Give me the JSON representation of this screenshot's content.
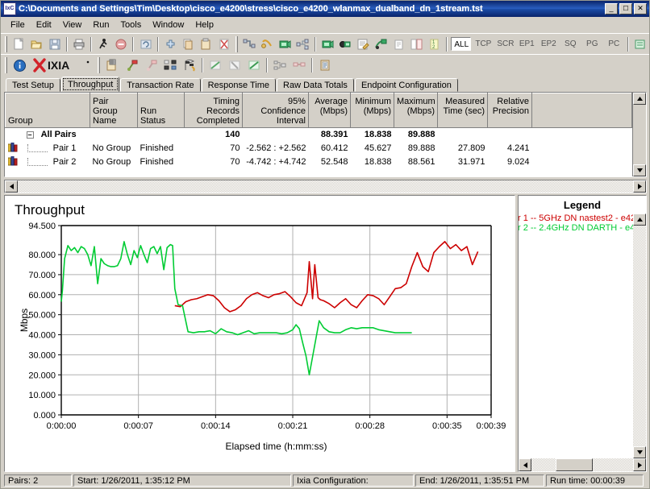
{
  "window": {
    "title": "C:\\Documents and Settings\\Tim\\Desktop\\cisco_e4200\\stress\\cisco_e4200_wlanmax_dualband_dn_1stream.tst",
    "icon": "ixchariot-icon",
    "minimize_label": "_",
    "maximize_label": "□",
    "close_label": "✕"
  },
  "menu": {
    "items": [
      "File",
      "Edit",
      "View",
      "Run",
      "Tools",
      "Window",
      "Help"
    ]
  },
  "toolbar": {
    "filter_buttons": [
      "ALL",
      "TCP",
      "SCR",
      "EP1",
      "EP2",
      "SQ",
      "PG",
      "PC"
    ],
    "filter_selected": "ALL",
    "brand": "IXIA"
  },
  "tabs": {
    "items": [
      "Test Setup",
      "Throughput",
      "Transaction Rate",
      "Response Time",
      "Raw Data Totals",
      "Endpoint Configuration"
    ],
    "active": "Throughput"
  },
  "table": {
    "columns": [
      "Group",
      "Pair Group Name",
      "Run Status",
      "Timing Records Completed",
      "95% Confidence Interval",
      "Average (Mbps)",
      "Minimum (Mbps)",
      "Maximum (Mbps)",
      "Measured Time (sec)",
      "Relative Precision",
      ""
    ],
    "rows": [
      {
        "type": "group",
        "group": "All Pairs",
        "pair_group_name": "",
        "run_status": "",
        "timing_records": "140",
        "confidence": "",
        "average": "88.391",
        "minimum": "18.838",
        "maximum": "89.888",
        "measured_time": "",
        "relative_precision": ""
      },
      {
        "type": "pair",
        "group": "Pair 1",
        "pair_group_name": "No Group",
        "run_status": "Finished",
        "timing_records": "70",
        "confidence": "-2.562 : +2.562",
        "average": "60.412",
        "minimum": "45.627",
        "maximum": "89.888",
        "measured_time": "27.809",
        "relative_precision": "4.241"
      },
      {
        "type": "pair",
        "group": "Pair 2",
        "pair_group_name": "No Group",
        "run_status": "Finished",
        "timing_records": "70",
        "confidence": "-4.742 : +4.742",
        "average": "52.548",
        "minimum": "18.838",
        "maximum": "88.561",
        "measured_time": "31.971",
        "relative_precision": "9.024"
      }
    ]
  },
  "legend": {
    "title": "Legend",
    "entries": [
      {
        "label": "r 1 -- 5GHz DN nastest2 - e42",
        "color": "#cc0000"
      },
      {
        "label": "r 2 -- 2.4GHz DN DARTH - e4",
        "color": "#00cc33"
      }
    ]
  },
  "statusbar": {
    "pairs": "Pairs: 2",
    "start": "Start: 1/26/2011, 1:35:12 PM",
    "configuration": "Ixia Configuration:",
    "end": "End: 1/26/2011, 1:35:51 PM",
    "runtime": "Run time: 00:00:39"
  },
  "chart_data": {
    "type": "line",
    "title": "Throughput",
    "xlabel": "Elapsed time (h:mm:ss)",
    "ylabel": "Mbps",
    "ylim": [
      0,
      94.5
    ],
    "yticks": [
      "0.000",
      "10.000",
      "20.000",
      "30.000",
      "40.000",
      "50.000",
      "60.000",
      "70.000",
      "80.000",
      "94.500"
    ],
    "ytick_values": [
      0,
      10,
      20,
      30,
      40,
      50,
      60,
      70,
      80,
      94.5
    ],
    "xlim": [
      0,
      39
    ],
    "xticks": [
      "0:00:00",
      "0:00:07",
      "0:00:14",
      "0:00:21",
      "0:00:28",
      "0:00:35",
      "0:00:39"
    ],
    "xtick_values": [
      0,
      7,
      14,
      21,
      28,
      35,
      39
    ],
    "grid": true,
    "legend_position": "right-panel",
    "series": [
      {
        "name": "r 1 -- 5GHz DN nastest2 - e42",
        "color": "#cc0000",
        "x": [
          10.3,
          10.8,
          11.3,
          11.8,
          12.3,
          12.8,
          13.3,
          13.8,
          14.3,
          14.8,
          15.3,
          15.8,
          16.3,
          16.8,
          17.3,
          17.8,
          18.3,
          18.8,
          19.3,
          19.8,
          20.3,
          20.8,
          21.3,
          21.8,
          22.3,
          22.5,
          22.8,
          23.0,
          23.3,
          23.5,
          23.8,
          24.3,
          24.8,
          25.3,
          25.8,
          26.3,
          26.8,
          27.3,
          27.8,
          28.3,
          28.8,
          29.3,
          29.8,
          30.3,
          30.8,
          31.3,
          31.8,
          32.3,
          32.8,
          33.3,
          33.8,
          34.3,
          34.8,
          35.3,
          35.8,
          36.3,
          36.8,
          37.3,
          37.8
        ],
        "y": [
          54.5,
          54.0,
          56.5,
          57.5,
          58.0,
          59.0,
          60.0,
          59.5,
          57.0,
          53.5,
          51.5,
          52.5,
          54.5,
          58.0,
          60.0,
          61.0,
          59.5,
          58.5,
          60.0,
          60.5,
          61.5,
          59.0,
          56.0,
          54.5,
          61.0,
          76.5,
          58.0,
          75.0,
          58.5,
          57.5,
          57.0,
          55.5,
          53.5,
          56.0,
          58.0,
          55.0,
          53.5,
          57.0,
          60.0,
          59.5,
          58.0,
          55.0,
          59.0,
          63.0,
          63.5,
          65.5,
          74.0,
          81.0,
          74.0,
          71.5,
          81.0,
          84.0,
          86.5,
          83.0,
          85.0,
          82.0,
          84.0,
          75.0,
          81.5
        ]
      },
      {
        "name": "r 2 -- 2.4GHz DN DARTH - e4",
        "color": "#00cc33",
        "x": [
          0.0,
          0.1,
          0.3,
          0.6,
          0.9,
          1.2,
          1.5,
          1.8,
          2.1,
          2.4,
          2.7,
          3.0,
          3.3,
          3.6,
          3.9,
          4.2,
          4.5,
          4.8,
          5.1,
          5.4,
          5.7,
          6.0,
          6.3,
          6.6,
          6.9,
          7.2,
          7.5,
          7.8,
          8.1,
          8.4,
          8.7,
          9.0,
          9.3,
          9.6,
          9.9,
          10.1,
          10.3,
          10.6,
          11.0,
          11.5,
          12.0,
          12.5,
          13.0,
          13.5,
          14.0,
          14.5,
          15.0,
          15.5,
          16.0,
          16.5,
          17.0,
          17.5,
          18.0,
          18.5,
          19.0,
          19.5,
          20.0,
          20.5,
          21.0,
          21.3,
          21.6,
          21.9,
          22.2,
          22.5,
          22.8,
          23.1,
          23.4,
          23.8,
          24.3,
          24.8,
          25.3,
          25.8,
          26.3,
          26.8,
          27.3,
          27.8,
          28.3,
          28.8,
          29.3,
          29.8,
          30.3,
          30.8,
          31.3,
          31.8
        ],
        "y": [
          56.5,
          62.0,
          78.0,
          84.5,
          82.0,
          83.5,
          81.0,
          84.0,
          83.0,
          80.0,
          74.5,
          84.0,
          65.5,
          78.0,
          75.5,
          74.5,
          74.0,
          74.0,
          74.5,
          78.0,
          86.5,
          80.0,
          75.0,
          82.0,
          78.5,
          84.5,
          80.0,
          76.0,
          83.0,
          84.0,
          80.5,
          84.0,
          72.5,
          83.5,
          85.0,
          84.5,
          63.0,
          55.0,
          54.5,
          41.5,
          41.0,
          41.5,
          41.5,
          42.0,
          40.5,
          43.0,
          41.5,
          41.0,
          40.0,
          41.0,
          42.0,
          40.5,
          41.0,
          41.0,
          41.0,
          41.0,
          40.5,
          41.0,
          42.5,
          45.0,
          43.0,
          36.0,
          29.5,
          20.0,
          29.0,
          38.0,
          47.0,
          43.5,
          41.5,
          41.0,
          41.0,
          42.5,
          43.5,
          43.0,
          43.5,
          43.5,
          43.5,
          42.5,
          42.0,
          41.5,
          41.0,
          41.0,
          41.0,
          41.0
        ]
      }
    ]
  }
}
